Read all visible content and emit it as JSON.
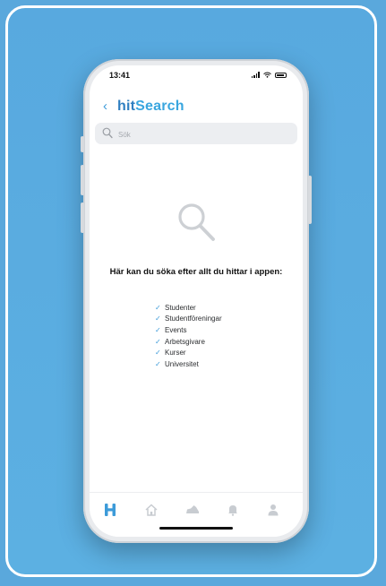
{
  "status_bar": {
    "time": "13:41"
  },
  "header": {
    "back_icon": "chevron-left-icon",
    "title_part1": "hit",
    "title_part2": "Search"
  },
  "search": {
    "placeholder": "Sök",
    "value": ""
  },
  "empty_state": {
    "icon": "magnifier-icon",
    "heading": "Här kan du söka efter allt du hittar i appen:",
    "items": [
      "Studenter",
      "Studentföreningar",
      "Events",
      "Arbetsgivare",
      "Kurser",
      "Universitet"
    ]
  },
  "tab_bar": {
    "tabs": [
      "h-logo-icon",
      "home-icon",
      "shoe-icon",
      "bell-icon",
      "user-icon"
    ],
    "active_index": 0
  },
  "colors": {
    "accent": "#3d9bd9",
    "brand_dark": "#2f7fc1",
    "background": "#5aa8dc",
    "inactive_icon": "#c8ccd1"
  }
}
